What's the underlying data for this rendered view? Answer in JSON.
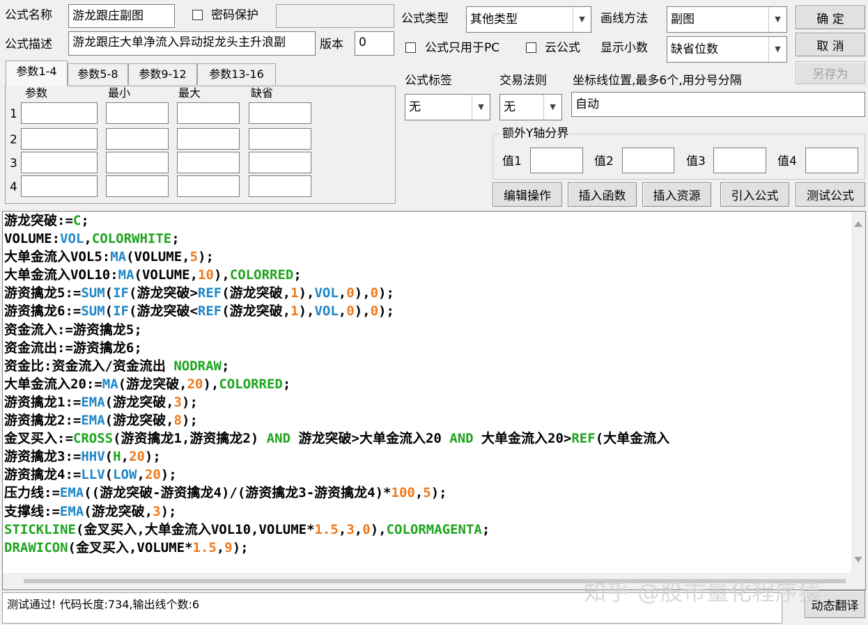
{
  "form": {
    "name_label": "公式名称",
    "name_value": "游龙跟庄副图",
    "password_label": "密码保护",
    "desc_label": "公式描述",
    "desc_value": "游龙跟庄大单净流入异动捉龙头主升浪副",
    "version_label": "版本",
    "version_value": "0",
    "type_label": "公式类型",
    "type_value": "其他类型",
    "draw_label": "画线方法",
    "draw_value": "副图",
    "pc_only_label": "公式只用于PC",
    "cloud_label": "云公式",
    "decimals_label": "显示小数",
    "decimals_value": "缺省位数",
    "tag_label": "公式标签",
    "tag_value": "无",
    "rule_label": "交易法则",
    "rule_value": "无",
    "axis_label": "坐标线位置,最多6个,用分号分隔",
    "axis_value": "自动",
    "extra_y_label": "额外Y轴分界",
    "val1_label": "值1",
    "val2_label": "值2",
    "val3_label": "值3",
    "val4_label": "值4"
  },
  "buttons": {
    "ok": "确 定",
    "cancel": "取 消",
    "save_as": "另存为",
    "edit_ops": "编辑操作",
    "insert_func": "插入函数",
    "insert_res": "插入资源",
    "import_formula": "引入公式",
    "test_formula": "测试公式",
    "translate": "动态翻译"
  },
  "tabs": [
    "参数1-4",
    "参数5-8",
    "参数9-12",
    "参数13-16"
  ],
  "params": {
    "headers": [
      "参数",
      "最小",
      "最大",
      "缺省"
    ],
    "rows": [
      "1",
      "2",
      "3",
      "4"
    ]
  },
  "code_lines": [
    [
      [
        "t",
        "游龙突破:="
      ],
      [
        "k",
        "C"
      ],
      [
        "t",
        ";"
      ]
    ],
    [
      [
        "t",
        "VOLUME:"
      ],
      [
        "f",
        "VOL"
      ],
      [
        "t",
        ","
      ],
      [
        "k",
        "COLORWHITE"
      ],
      [
        "t",
        ";"
      ]
    ],
    [
      [
        "t",
        "大单金流入VOL5:"
      ],
      [
        "f",
        "MA"
      ],
      [
        "t",
        "(VOLUME,"
      ],
      [
        "n",
        "5"
      ],
      [
        "t",
        ");"
      ]
    ],
    [
      [
        "t",
        "大单金流入VOL10:"
      ],
      [
        "f",
        "MA"
      ],
      [
        "t",
        "(VOLUME,"
      ],
      [
        "n",
        "10"
      ],
      [
        "t",
        "),"
      ],
      [
        "k",
        "COLORRED"
      ],
      [
        "t",
        ";"
      ]
    ],
    [
      [
        "t",
        "游资擒龙5:="
      ],
      [
        "f",
        "SUM"
      ],
      [
        "t",
        "("
      ],
      [
        "f",
        "IF"
      ],
      [
        "t",
        "(游龙突破>"
      ],
      [
        "f",
        "REF"
      ],
      [
        "t",
        "(游龙突破,"
      ],
      [
        "n",
        "1"
      ],
      [
        "t",
        "),"
      ],
      [
        "f",
        "VOL"
      ],
      [
        "t",
        ","
      ],
      [
        "n",
        "0"
      ],
      [
        "t",
        "),"
      ],
      [
        "n",
        "0"
      ],
      [
        "t",
        ");"
      ]
    ],
    [
      [
        "t",
        "游资擒龙6:="
      ],
      [
        "f",
        "SUM"
      ],
      [
        "t",
        "("
      ],
      [
        "f",
        "IF"
      ],
      [
        "t",
        "(游龙突破<"
      ],
      [
        "f",
        "REF"
      ],
      [
        "t",
        "(游龙突破,"
      ],
      [
        "n",
        "1"
      ],
      [
        "t",
        "),"
      ],
      [
        "f",
        "VOL"
      ],
      [
        "t",
        ","
      ],
      [
        "n",
        "0"
      ],
      [
        "t",
        "),"
      ],
      [
        "n",
        "0"
      ],
      [
        "t",
        ");"
      ]
    ],
    [
      [
        "t",
        "资金流入:=游资擒龙5;"
      ]
    ],
    [
      [
        "t",
        "资金流出:=游资擒龙6;"
      ]
    ],
    [
      [
        "t",
        "资金比:资金流入/资金流出 "
      ],
      [
        "k",
        "NODRAW"
      ],
      [
        "t",
        ";"
      ]
    ],
    [
      [
        "t",
        "大单金流入20:="
      ],
      [
        "f",
        "MA"
      ],
      [
        "t",
        "(游龙突破,"
      ],
      [
        "n",
        "20"
      ],
      [
        "t",
        "),"
      ],
      [
        "k",
        "COLORRED"
      ],
      [
        "t",
        ";"
      ]
    ],
    [
      [
        "t",
        "游资擒龙1:="
      ],
      [
        "f",
        "EMA"
      ],
      [
        "t",
        "(游龙突破,"
      ],
      [
        "n",
        "3"
      ],
      [
        "t",
        ");"
      ]
    ],
    [
      [
        "t",
        "游资擒龙2:="
      ],
      [
        "f",
        "EMA"
      ],
      [
        "t",
        "(游龙突破,"
      ],
      [
        "n",
        "8"
      ],
      [
        "t",
        ");"
      ]
    ],
    [
      [
        "t",
        "金叉买入:="
      ],
      [
        "k",
        "CROSS"
      ],
      [
        "t",
        "(游资擒龙1,游资擒龙2) "
      ],
      [
        "k",
        "AND"
      ],
      [
        "t",
        " 游龙突破>大单金流入20 "
      ],
      [
        "k",
        "AND"
      ],
      [
        "t",
        " 大单金流入20>"
      ],
      [
        "k",
        "REF"
      ],
      [
        "t",
        "(大单金流入"
      ]
    ],
    [
      [
        "t",
        "游资擒龙3:="
      ],
      [
        "f",
        "HHV"
      ],
      [
        "t",
        "("
      ],
      [
        "k",
        "H"
      ],
      [
        "t",
        ","
      ],
      [
        "n",
        "20"
      ],
      [
        "t",
        ");"
      ]
    ],
    [
      [
        "t",
        "游资擒龙4:="
      ],
      [
        "f",
        "LLV"
      ],
      [
        "t",
        "("
      ],
      [
        "f",
        "LOW"
      ],
      [
        "t",
        ","
      ],
      [
        "n",
        "20"
      ],
      [
        "t",
        ");"
      ]
    ],
    [
      [
        "t",
        "压力线:="
      ],
      [
        "f",
        "EMA"
      ],
      [
        "t",
        "((游龙突破-游资擒龙4)/(游资擒龙3-游资擒龙4)*"
      ],
      [
        "n",
        "100"
      ],
      [
        "t",
        ","
      ],
      [
        "n",
        "5"
      ],
      [
        "t",
        ");"
      ]
    ],
    [
      [
        "t",
        "支撑线:="
      ],
      [
        "f",
        "EMA"
      ],
      [
        "t",
        "(游龙突破,"
      ],
      [
        "n",
        "3"
      ],
      [
        "t",
        ");"
      ]
    ],
    [
      [
        "k",
        "STICKLINE"
      ],
      [
        "t",
        "(金叉买入,大单金流入VOL10,VOLUME*"
      ],
      [
        "n",
        "1.5"
      ],
      [
        "t",
        ","
      ],
      [
        "n",
        "3"
      ],
      [
        "t",
        ","
      ],
      [
        "n",
        "0"
      ],
      [
        "t",
        "),"
      ],
      [
        "k",
        "COLORMAGENTA"
      ],
      [
        "t",
        ";"
      ]
    ],
    [
      [
        "k",
        "DRAWICON"
      ],
      [
        "t",
        "(金叉买入,VOLUME*"
      ],
      [
        "n",
        "1.5"
      ],
      [
        "t",
        ","
      ],
      [
        "n",
        "9"
      ],
      [
        "t",
        ");"
      ]
    ]
  ],
  "status": "测试通过! 代码长度:734,输出线个数:6",
  "watermark": "知乎 @股市量化程序猿",
  "colors": {
    "func_blue": "#1e86c8",
    "number_orange": "#f07818",
    "keyword_green": "#1ea41e"
  }
}
